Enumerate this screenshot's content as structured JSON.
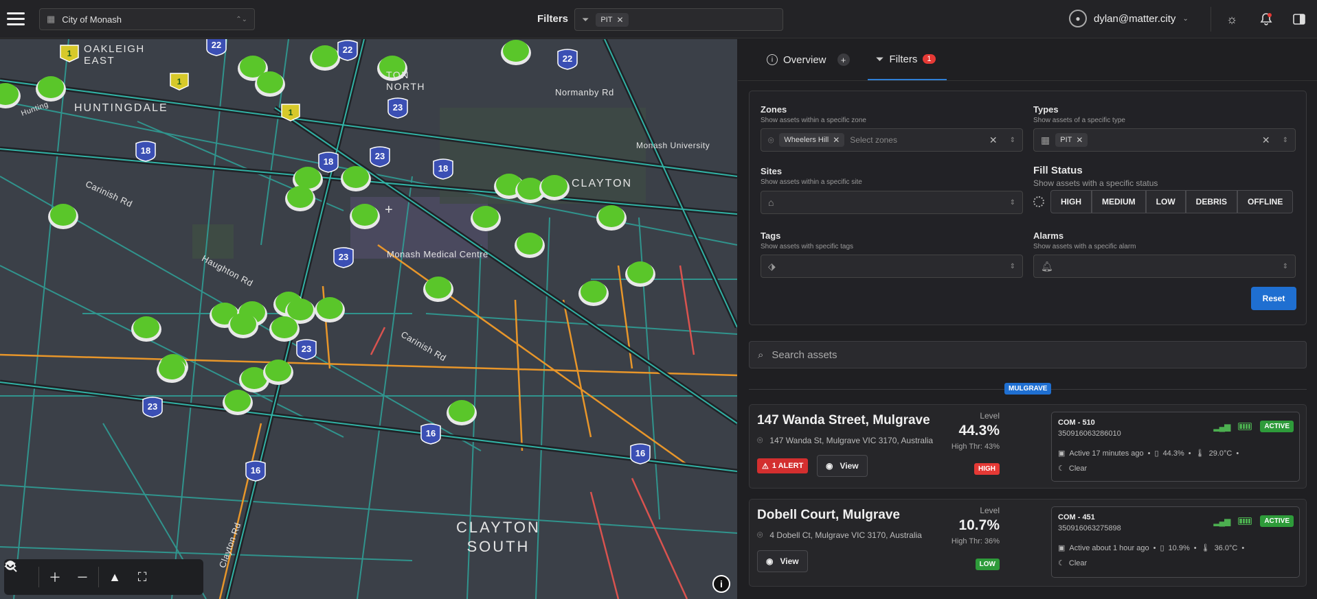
{
  "header": {
    "org_name": "City of Monash",
    "filters_label": "Filters",
    "active_filter_chip": "PIT",
    "user_email": "dylan@matter.city"
  },
  "map": {
    "labels": {
      "oakleigh_east": "OAKLEIGH\nEAST",
      "huntingdale": "HUNTINGDALE",
      "notting_north": "TON\nNORTH",
      "normanby": "Normanby Rd",
      "monash_uni": "Monash University",
      "clayton": "CLAYTON",
      "carinish_1": "Carinish Rd",
      "carinish_2": "Carinish Rd",
      "haughton": "Haughton Rd",
      "medical": "Monash Medical Centre",
      "clayton_rd": "Clayton Rd",
      "clayton_south": "CLAYTON\nSOUTH",
      "hunting_partial": "Hunting"
    },
    "route_shields": [
      "22",
      "22",
      "22",
      "1",
      "1",
      "1",
      "18",
      "18",
      "18",
      "23",
      "23",
      "23",
      "23",
      "23",
      "16",
      "16",
      "16"
    ],
    "info_label": "i"
  },
  "panel": {
    "tabs": [
      {
        "label": "Overview"
      },
      {
        "label": "Filters",
        "count": "1"
      }
    ],
    "zones": {
      "title": "Zones",
      "subtitle": "Show assets within a specific zone",
      "chip": "Wheelers Hill",
      "placeholder": "Select zones"
    },
    "types": {
      "title": "Types",
      "subtitle": "Show assets of a specific type",
      "chip": "PIT"
    },
    "sites": {
      "title": "Sites",
      "subtitle": "Show assets within a specific site"
    },
    "fill_status": {
      "title": "Fill Status",
      "subtitle": "Show assets with a specific status",
      "options": [
        "HIGH",
        "MEDIUM",
        "LOW",
        "DEBRIS",
        "OFFLINE"
      ]
    },
    "tags": {
      "title": "Tags",
      "subtitle": "Show assets with specific tags"
    },
    "alarms": {
      "title": "Alarms",
      "subtitle": "Show assets with a specific alarm"
    },
    "reset_label": "Reset",
    "search_placeholder": "Search assets",
    "zone_group": "MULGRAVE",
    "assets": [
      {
        "title": "147 Wanda Street, Mulgrave",
        "address": "147 Wanda St, Mulgrave VIC 3170, Australia",
        "level_label": "Level",
        "level": "44.3%",
        "threshold": "High Thr: 43%",
        "level_badge": "HIGH",
        "alert": "1 ALERT",
        "view_label": "View",
        "device": {
          "name": "COM - 510",
          "serial": "350916063286010",
          "status": "ACTIVE",
          "activity": "Active 17 minutes ago",
          "fill": "44.3%",
          "temp": "29.0°C",
          "condition": "Clear"
        }
      },
      {
        "title": "Dobell Court, Mulgrave",
        "address": "4 Dobell Ct, Mulgrave VIC 3170, Australia",
        "level_label": "Level",
        "level": "10.7%",
        "threshold": "High Thr: 36%",
        "level_badge": "LOW",
        "view_label": "View",
        "device": {
          "name": "COM - 451",
          "serial": "350916063275898",
          "status": "ACTIVE",
          "activity": "Active about 1 hour ago",
          "fill": "10.9%",
          "temp": "36.0°C",
          "condition": "Clear"
        }
      }
    ]
  },
  "colors": {
    "marker": "#5ac62a",
    "accent": "#1f6fd1",
    "alert": "#d32f2f",
    "high": "#e53935",
    "low": "#2e9b3a"
  }
}
